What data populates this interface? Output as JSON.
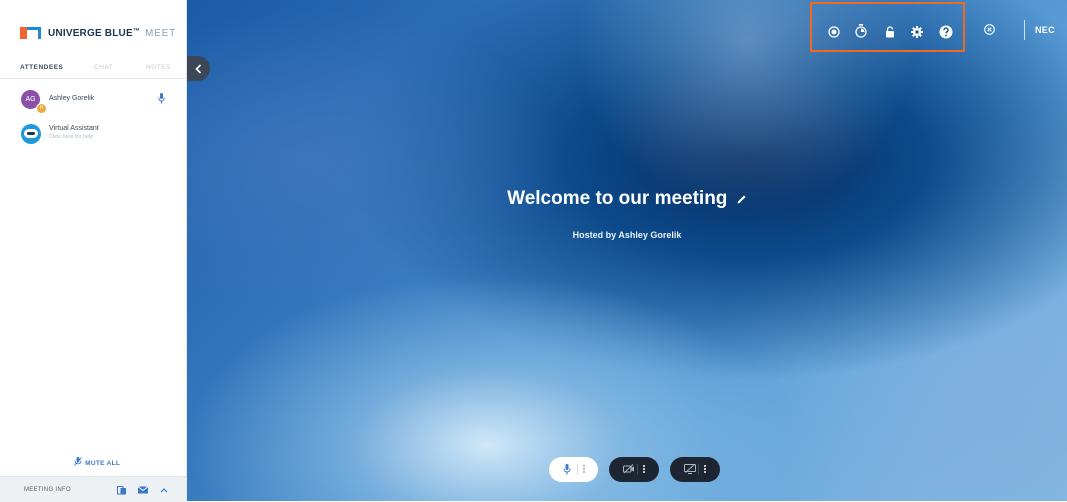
{
  "brand": {
    "name": "UNIVERGE BLUE",
    "tm": "™",
    "product": "MEET"
  },
  "tabs": [
    {
      "label": "ATTENDEES",
      "active": true
    },
    {
      "label": "CHAT",
      "active": false
    },
    {
      "label": "NOTES",
      "active": false
    }
  ],
  "attendees": [
    {
      "initials": "AG",
      "name": "Ashley Gorelik",
      "host_badge": "H"
    }
  ],
  "assistant": {
    "name": "Virtual Assistant",
    "subtitle": "Click here for help"
  },
  "mute_all_label": "MUTE ALL",
  "footer": {
    "label": "MEETING INFO"
  },
  "meeting": {
    "title": "Welcome to our meeting",
    "host_line": "Hosted by Ashley Gorelik"
  },
  "header_icons": [
    "record-icon",
    "timer-icon",
    "lock-icon",
    "gear-icon",
    "help-icon"
  ],
  "vendor_logo": "NEC",
  "colors": {
    "accent_blue": "#3b78c8",
    "brand_orange": "#f0642d",
    "highlight_box": "#ee6a22",
    "control_dark": "#1d2533"
  }
}
